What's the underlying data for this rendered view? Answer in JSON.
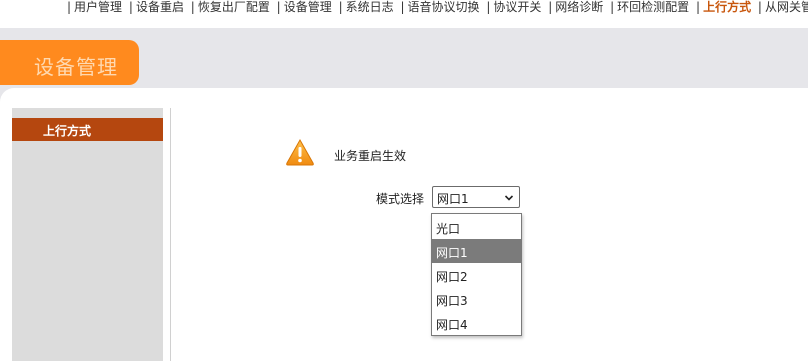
{
  "topnav": {
    "items": [
      {
        "label": "用户管理",
        "active": false
      },
      {
        "label": "设备重启",
        "active": false
      },
      {
        "label": "恢复出厂配置",
        "active": false
      },
      {
        "label": "设备管理",
        "active": false
      },
      {
        "label": "系统日志",
        "active": false
      },
      {
        "label": "语音协议切换",
        "active": false
      },
      {
        "label": "协议开关",
        "active": false
      },
      {
        "label": "网络诊断",
        "active": false
      },
      {
        "label": "环回检测配置",
        "active": false
      },
      {
        "label": "上行方式",
        "active": true
      },
      {
        "label": "从网关管理",
        "active": false
      }
    ],
    "separator": "|"
  },
  "header": {
    "title": "设备管理"
  },
  "sidebar": {
    "items": [
      {
        "label": "上行方式",
        "active": true
      }
    ]
  },
  "main": {
    "notice": "业务重启生效",
    "notice_icon": "warning-icon",
    "mode_label": "模式选择",
    "mode_value": "网口1",
    "options": [
      "光口",
      "网口1",
      "网口2",
      "网口3",
      "网口4"
    ],
    "selected_option": "网口1"
  },
  "colors": {
    "accent": "#ff8a1e",
    "sidebar_active": "#b5470f",
    "nav_active": "#c8560c",
    "band": "#e6e6ea",
    "option_highlight": "#7b7b7b"
  }
}
